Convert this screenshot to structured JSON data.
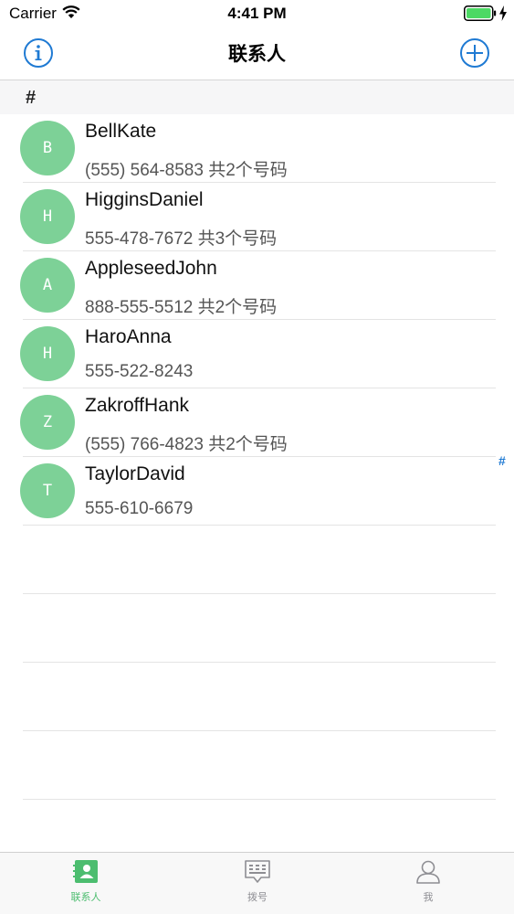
{
  "status_bar": {
    "carrier": "Carrier",
    "time": "4:41 PM",
    "icons": [
      "wifi-icon",
      "battery-icon",
      "charging-bolt-icon"
    ]
  },
  "nav": {
    "title": "联系人",
    "left_icon": "info-icon",
    "right_icon": "add-circle-icon"
  },
  "section": {
    "header": "#"
  },
  "contacts": [
    {
      "initial": "B",
      "name": "BellKate",
      "phone": "(555) 564-8583 共2个号码"
    },
    {
      "initial": "H",
      "name": "HigginsDaniel",
      "phone": "555-478-7672 共3个号码"
    },
    {
      "initial": "A",
      "name": "AppleseedJohn",
      "phone": "888-555-5512 共2个号码"
    },
    {
      "initial": "H",
      "name": "HaroAnna",
      "phone": "555-522-8243"
    },
    {
      "initial": "Z",
      "name": "ZakroffHank",
      "phone": "(555) 766-4823 共2个号码"
    },
    {
      "initial": "T",
      "name": "TaylorDavid",
      "phone": "555-610-6679"
    }
  ],
  "index": [
    "#"
  ],
  "tabs": [
    {
      "label": "联系人",
      "icon": "contacts-book-icon",
      "active": true
    },
    {
      "label": "拨号",
      "icon": "dialpad-icon",
      "active": false
    },
    {
      "label": "我",
      "icon": "person-icon",
      "active": false
    }
  ],
  "colors": {
    "accent": "#1f7ad3",
    "avatar": "#7dd197",
    "tab_active": "#4cbd6f",
    "tab_inactive": "#8e8e93"
  }
}
